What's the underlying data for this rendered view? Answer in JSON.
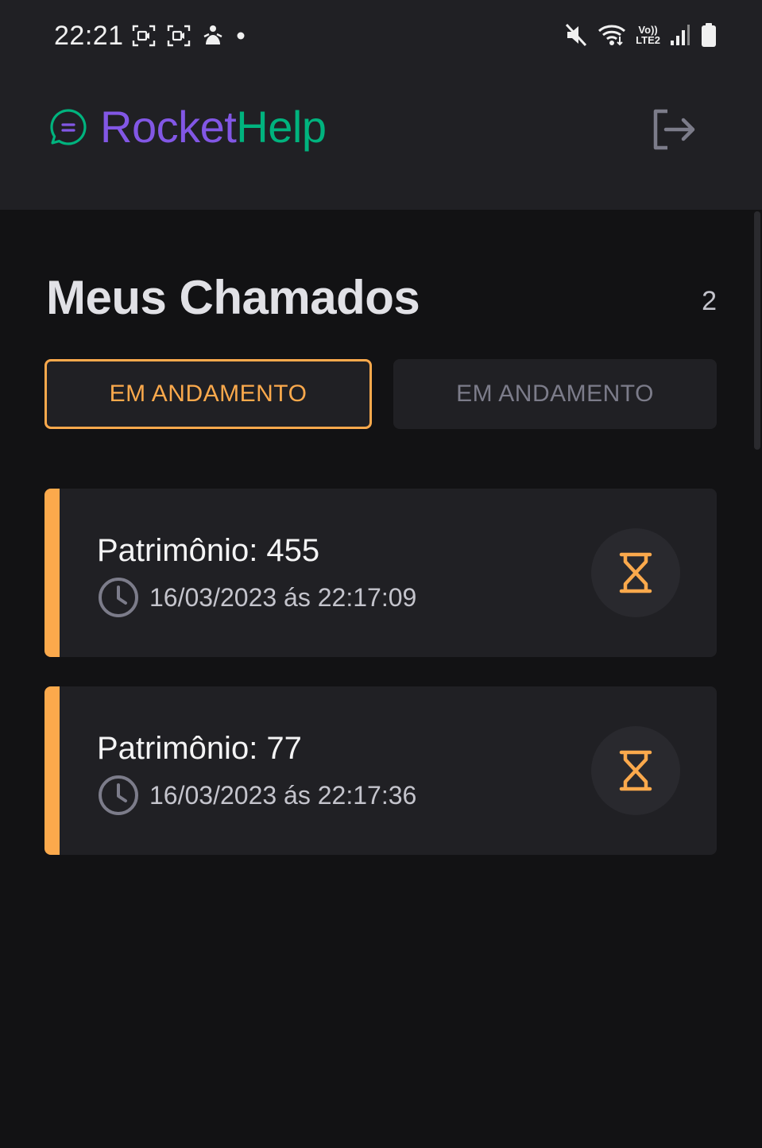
{
  "status_bar": {
    "time": "22:21",
    "lte_top": "Vo))",
    "lte_bottom": "LTE2"
  },
  "header": {
    "brand_part1": "Rocket",
    "brand_part2": "Help",
    "logout_icon": "logout-icon"
  },
  "main": {
    "title": "Meus Chamados",
    "count": "2",
    "filters": [
      {
        "label": "EM ANDAMENTO",
        "active": true
      },
      {
        "label": "EM ANDAMENTO",
        "active": false
      }
    ],
    "orders": [
      {
        "patrimony": "Patrimônio: 455",
        "when": "16/03/2023 ás 22:17:09",
        "status_icon": "hourglass-icon"
      },
      {
        "patrimony": "Patrimônio: 77",
        "when": "16/03/2023 ás 22:17:36",
        "status_icon": "hourglass-icon"
      }
    ]
  },
  "colors": {
    "background": "#121214",
    "surface": "#202024",
    "brand_purple": "#8257e5",
    "brand_green": "#00b37e",
    "accent_orange": "#fba94c",
    "text_muted": "#7c7c8a"
  }
}
